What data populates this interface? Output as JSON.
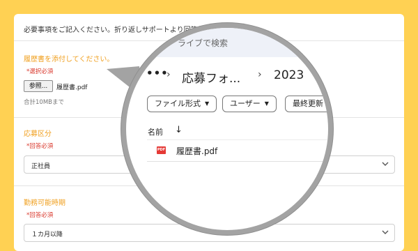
{
  "form": {
    "intro": "必要事項をご記入ください。折り返しサポートより回答差し上げます。",
    "resume": {
      "label": "履歴書を添付してください。",
      "required": "*選択必須",
      "browse_label": "参照...",
      "file_name": "履歴書.pdf",
      "limit_hint": "合計10MBまで"
    },
    "category": {
      "label": "応募区分",
      "required": "*回答必須",
      "value": "正社員"
    },
    "start": {
      "label": "勤務可能時期",
      "required": "*回答必須",
      "value": "１カ月以降"
    }
  },
  "drive": {
    "search_text": "ライブで検索",
    "breadcrumb": {
      "more": "•••",
      "sep": "›",
      "folder": "応募フォ...",
      "subfolder": "2023"
    },
    "filters": [
      "ファイル形式",
      "ユーザー",
      "最終更新"
    ],
    "column_name": "名前",
    "sort_arrow": "↓",
    "file": {
      "icon_text": "PDF",
      "name": "履歴書.pdf"
    }
  },
  "colors": {
    "background": "#ffd153",
    "accent_label": "#f0a020",
    "required": "#d9382c",
    "pdf": "#e53935"
  }
}
